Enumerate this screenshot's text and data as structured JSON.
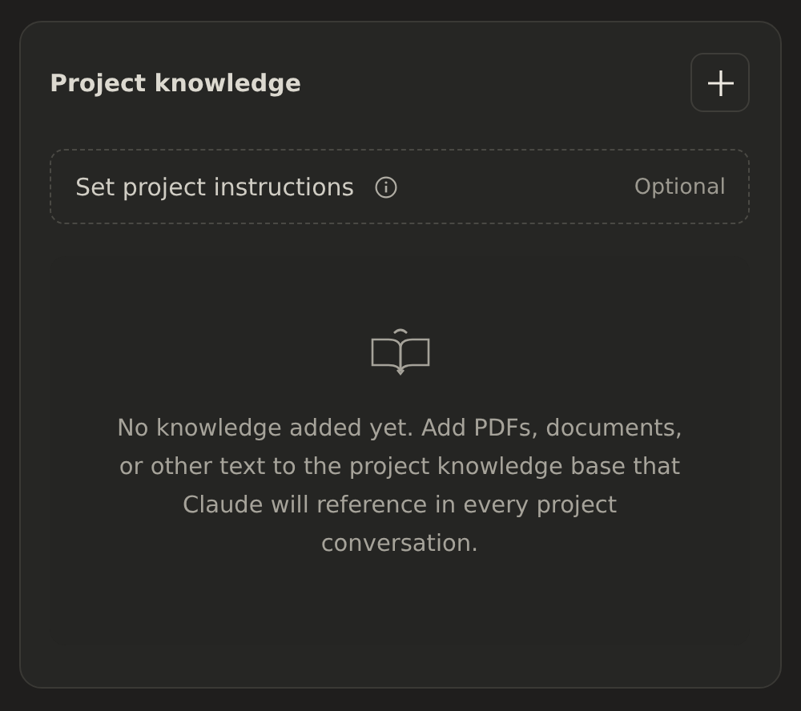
{
  "panel": {
    "title": "Project knowledge"
  },
  "instructions": {
    "label": "Set project instructions",
    "badge": "Optional"
  },
  "empty_state": {
    "message": "No knowledge added yet. Add PDFs, documents, or other text to the project knowledge base that Claude will reference in every project conversation."
  }
}
